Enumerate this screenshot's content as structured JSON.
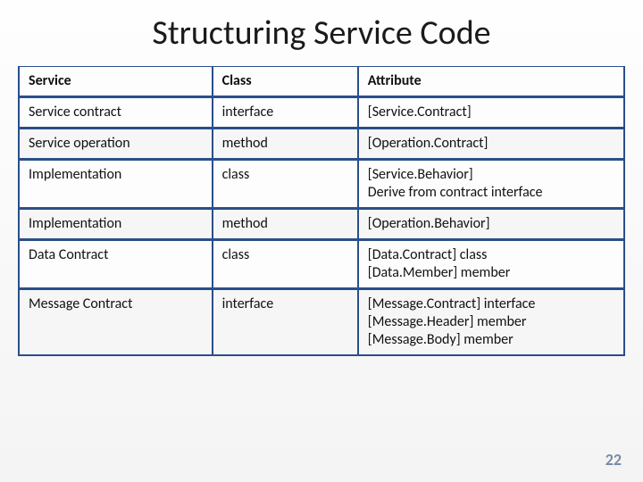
{
  "title": "Structuring Service Code",
  "page_number": "22",
  "table": {
    "headers": [
      "Service",
      "Class",
      "Attribute"
    ],
    "rows": [
      [
        "Service contract",
        "interface",
        "[Service.Contract]"
      ],
      [
        "Service operation",
        "method",
        "[Operation.Contract]"
      ],
      [
        "Implementation",
        "class",
        "[Service.Behavior]\nDerive from contract interface"
      ],
      [
        "Implementation",
        "method",
        "[Operation.Behavior]"
      ],
      [
        "Data Contract",
        "class",
        "[Data.Contract] class\n[Data.Member] member"
      ],
      [
        "Message Contract",
        "interface",
        "[Message.Contract] interface\n[Message.Header] member\n[Message.Body] member"
      ]
    ]
  }
}
